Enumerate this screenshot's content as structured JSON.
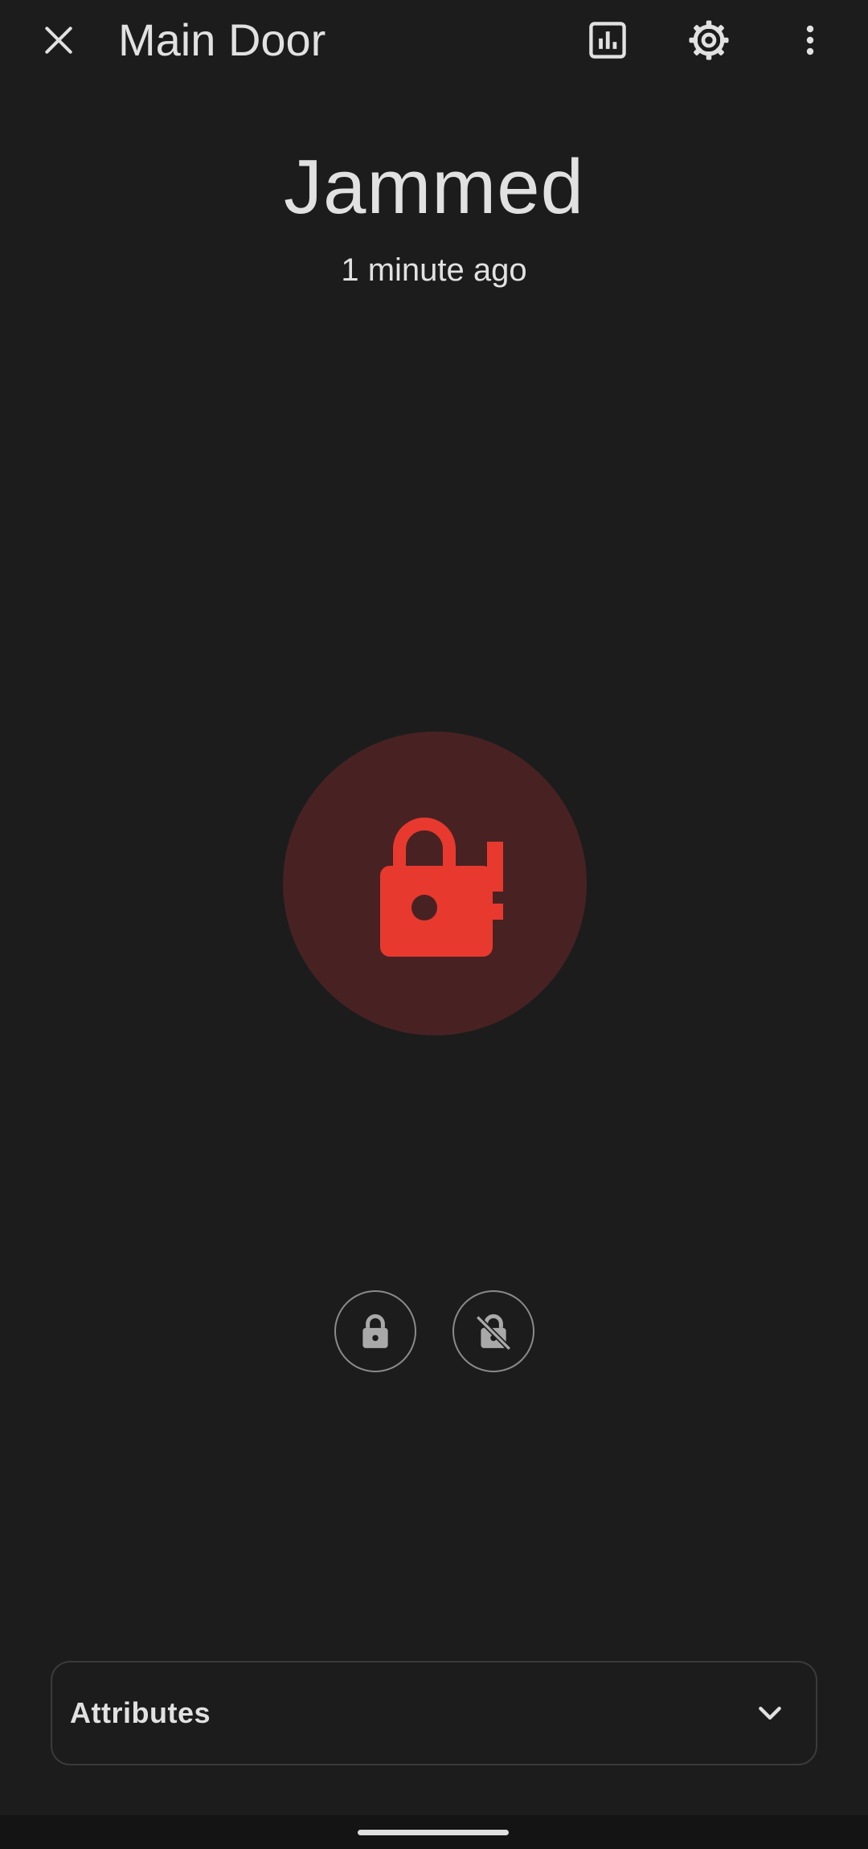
{
  "header": {
    "title": "Main Door",
    "icons": {
      "close": "close-icon",
      "history": "chart-icon",
      "settings": "gear-icon",
      "more": "more-vertical-icon"
    }
  },
  "state": {
    "label": "Jammed",
    "time_ago": "1 minute ago"
  },
  "main_control": {
    "icon": "lock-alert-icon",
    "color": "#e8392f",
    "background": "#482222"
  },
  "actions": [
    {
      "icon": "lock-icon"
    },
    {
      "icon": "lock-open-off-icon"
    }
  ],
  "attributes": {
    "label": "Attributes",
    "icon": "chevron-down-icon"
  },
  "colors": {
    "background": "#1c1c1c",
    "text": "#e1e1e1",
    "action_icon": "#a9a9a9"
  }
}
